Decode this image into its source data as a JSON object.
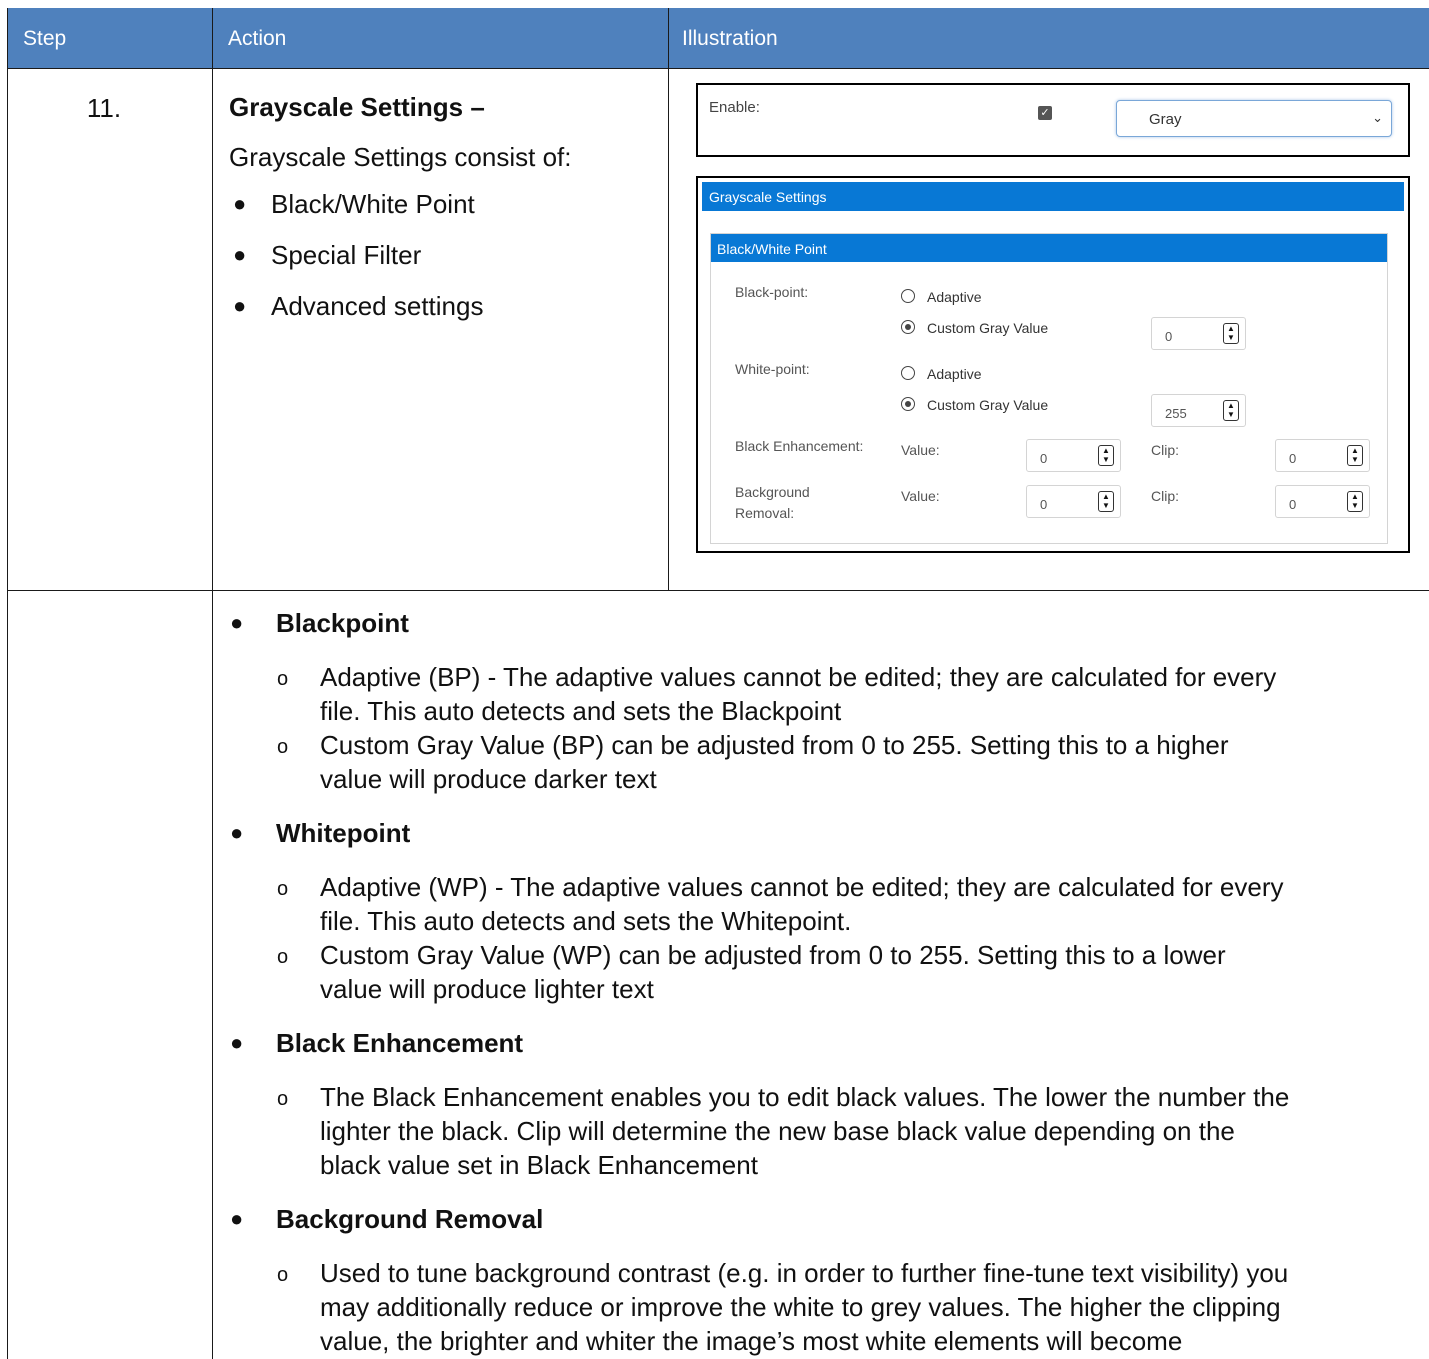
{
  "table": {
    "headers": {
      "step": "Step",
      "action": "Action",
      "illustration": "Illustration"
    }
  },
  "row1": {
    "step": "11.",
    "title": "Grayscale Settings –",
    "subtitle": "Grayscale Settings consist of:",
    "items": [
      "Black/White Point",
      "Special Filter",
      "Advanced settings"
    ]
  },
  "illustration": {
    "enable_label": "Enable:",
    "enable_checked": true,
    "mode_value": "Gray",
    "panel_title": "Grayscale Settings",
    "section_title": "Black/White Point",
    "black_point": {
      "label": "Black-point:",
      "adaptive": "Adaptive",
      "custom": "Custom Gray Value",
      "value": "0",
      "selected": "custom"
    },
    "white_point": {
      "label": "White-point:",
      "adaptive": "Adaptive",
      "custom": "Custom Gray Value",
      "value": "255",
      "selected": "custom"
    },
    "black_enhancement": {
      "label": "Black Enhancement:",
      "value_label": "Value:",
      "value": "0",
      "clip_label": "Clip:",
      "clip": "0"
    },
    "background_removal": {
      "label_line1": "Background",
      "label_line2": "Removal:",
      "value_label": "Value:",
      "value": "0",
      "clip_label": "Clip:",
      "clip": "0"
    },
    "colors": {
      "header_blue": "#0878d5",
      "table_header": "#4f81bd"
    }
  },
  "details": [
    {
      "title": "Blackpoint",
      "items": [
        [
          "Adaptive (BP) - The adaptive values cannot be edited; they are calculated for every",
          "file. This auto detects and sets the Blackpoint"
        ],
        [
          "Custom Gray Value (BP) can be adjusted from 0 to 255. Setting this to a higher",
          "value will produce darker text"
        ]
      ]
    },
    {
      "title": "Whitepoint",
      "items": [
        [
          "Adaptive (WP) - The adaptive values cannot be edited; they are calculated for every",
          "file. This auto detects and sets the Whitepoint."
        ],
        [
          "Custom Gray Value (WP) can be adjusted from 0 to 255. Setting this to a lower",
          "value will produce lighter text"
        ]
      ]
    },
    {
      "title": "Black Enhancement",
      "items": [
        [
          "The Black Enhancement enables you to edit black values. The lower the number the",
          "lighter the black. Clip will determine the new base black value depending on the",
          "black value set in Black Enhancement"
        ]
      ]
    },
    {
      "title": "Background Removal",
      "items": [
        [
          "Used to tune background contrast (e.g. in order to further fine-tune text visibility) you",
          "may additionally reduce or improve the white to grey values. The higher the clipping",
          "value, the brighter and whiter the image’s most white elements will become"
        ]
      ]
    }
  ]
}
